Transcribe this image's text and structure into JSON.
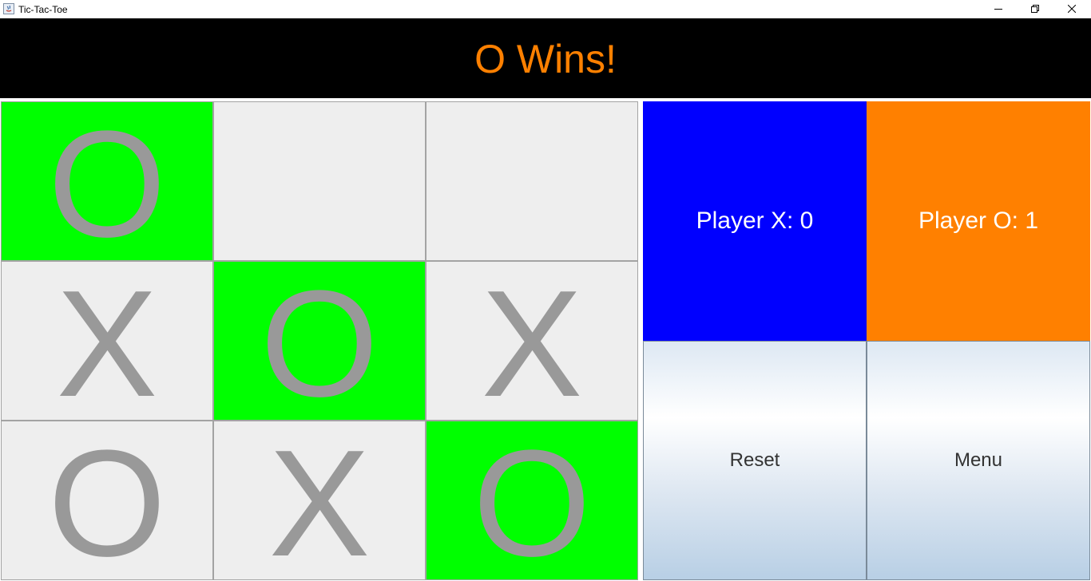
{
  "window": {
    "title": "Tic-Tac-Toe",
    "icons": [
      "java-app-icon",
      "minimize-icon",
      "maximize-icon",
      "close-icon"
    ]
  },
  "status": {
    "message": "O Wins!",
    "color": "#ff8000"
  },
  "board": {
    "cells": [
      {
        "mark": "O",
        "winning": true
      },
      {
        "mark": "",
        "winning": false
      },
      {
        "mark": "",
        "winning": false
      },
      {
        "mark": "X",
        "winning": false
      },
      {
        "mark": "O",
        "winning": true
      },
      {
        "mark": "X",
        "winning": false
      },
      {
        "mark": "O",
        "winning": false
      },
      {
        "mark": "X",
        "winning": false
      },
      {
        "mark": "O",
        "winning": true
      }
    ],
    "win_color": "#00ff00",
    "empty_color": "#eeeeee",
    "mark_color": "#999999"
  },
  "scores": {
    "x_label": "Player X: 0",
    "o_label": "Player O: 1",
    "x_color": "#0000ff",
    "o_color": "#ff8000"
  },
  "controls": {
    "reset_label": "Reset",
    "menu_label": "Menu"
  }
}
